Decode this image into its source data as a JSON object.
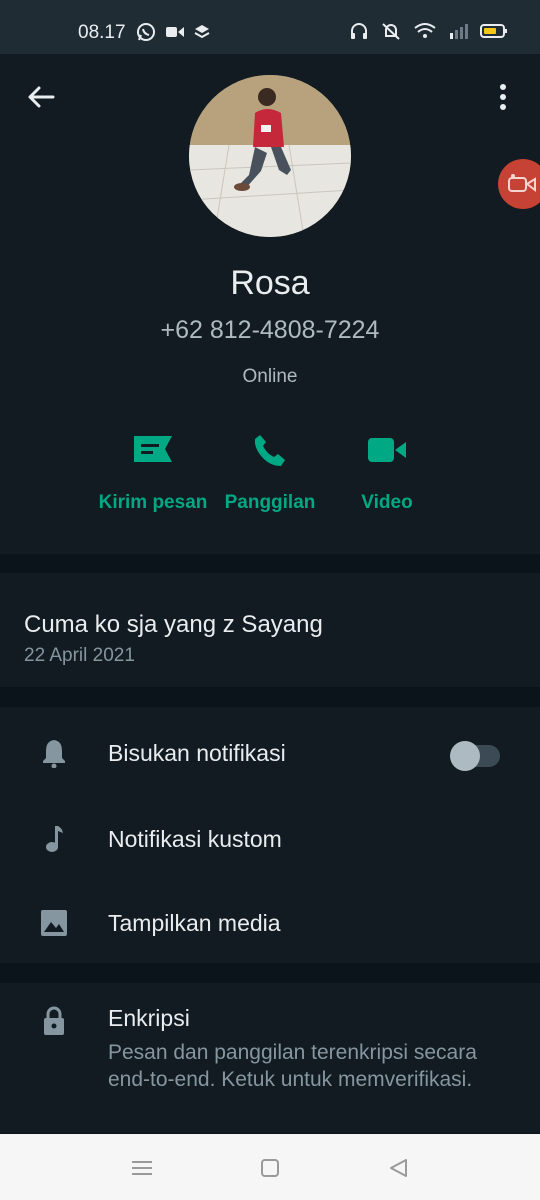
{
  "status_bar": {
    "time": "08.17",
    "left_icons": [
      "whatsapp-icon",
      "video-camera-icon",
      "layers-icon"
    ],
    "right_icons": [
      "headphones-icon",
      "mute-bell-icon",
      "wifi-icon",
      "signal-icon",
      "battery-icon"
    ]
  },
  "header": {
    "back_icon": "arrow-left-icon",
    "menu_icon": "more-vertical-icon"
  },
  "contact": {
    "name": "Rosa",
    "phone": "+62 812-4808-7224",
    "status": "Online"
  },
  "actions": [
    {
      "label": "Kirim pesan",
      "icon": "message-icon"
    },
    {
      "label": "Panggilan",
      "icon": "phone-icon"
    },
    {
      "label": "Video",
      "icon": "video-icon"
    }
  ],
  "about": {
    "text": "Cuma ko sja yang z Sayang",
    "date": "22 April 2021"
  },
  "settings": [
    {
      "label": "Bisukan notifikasi",
      "icon": "bell-icon",
      "toggle": false
    },
    {
      "label": "Notifikasi kustom",
      "icon": "music-note-icon"
    },
    {
      "label": "Tampilkan media",
      "icon": "image-icon"
    }
  ],
  "encryption": {
    "title": "Enkripsi",
    "description": "Pesan dan panggilan terenkripsi secara end-to-end. Ketuk untuk memverifikasi.",
    "icon": "lock-icon"
  },
  "nav_bar": [
    "menu-icon",
    "home-icon",
    "back-icon"
  ],
  "colors": {
    "accent": "#00a884",
    "background": "#111b21",
    "separator": "#0b141a",
    "floating_bubble": "#c64234"
  }
}
